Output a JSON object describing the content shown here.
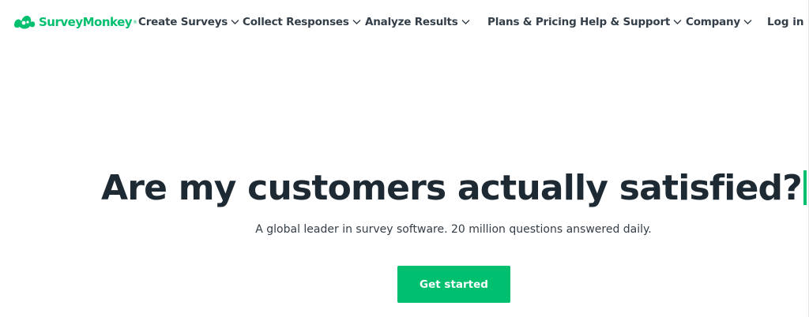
{
  "brand": {
    "name": "SurveyMonkey",
    "trademark": "®",
    "color": "#00bf6f"
  },
  "nav": {
    "items": [
      {
        "label": "Create Surveys",
        "has_dropdown": true
      },
      {
        "label": "Collect Responses",
        "has_dropdown": true
      },
      {
        "label": "Analyze Results",
        "has_dropdown": true
      },
      {
        "label": "Plans & Pricing",
        "has_dropdown": false
      },
      {
        "label": "Help & Support",
        "has_dropdown": true
      },
      {
        "label": "Company",
        "has_dropdown": true
      }
    ],
    "login_label": "Log in",
    "dropdown_icon": "chevron-down-icon"
  },
  "hero": {
    "headline": "Are my customers actually satisfied?",
    "subtitle": "A global leader in survey software. 20 million questions answered daily.",
    "cta_label": "Get started",
    "cta_color": "#00bf6f",
    "text_color": "#1e2a33"
  }
}
